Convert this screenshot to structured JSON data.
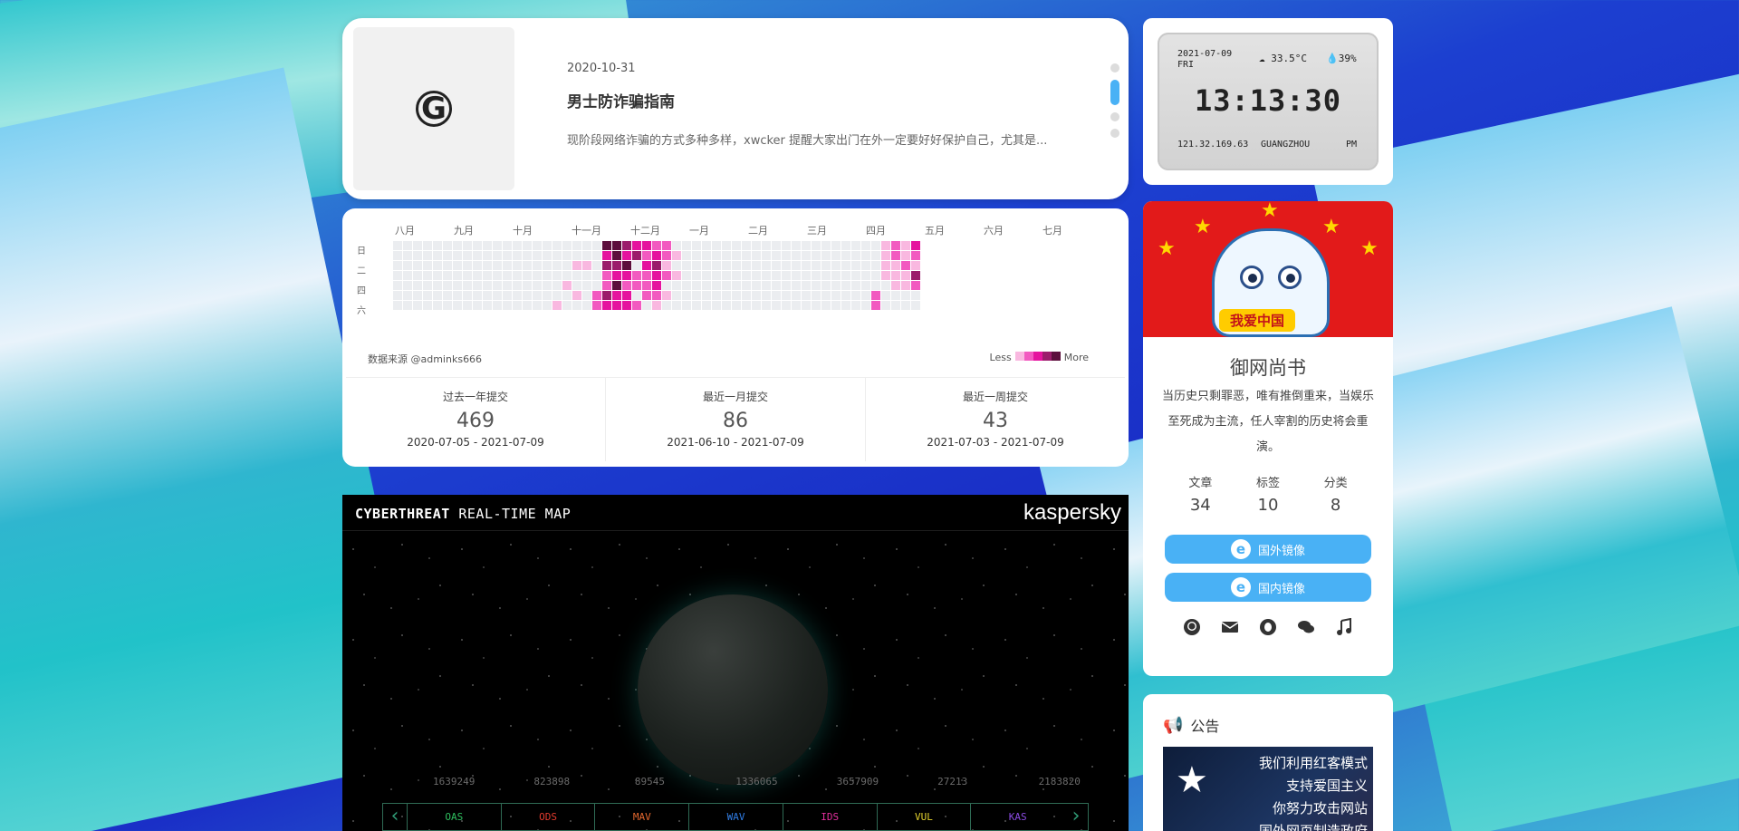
{
  "post": {
    "date": "2020-10-31",
    "title": "男士防诈骗指南",
    "excerpt": "现阶段网络诈骗的方式多种多样，xwcker 提醒大家出门在外一定要好好保护自己，尤其是...",
    "thumb_letter": "G"
  },
  "contributions": {
    "months": [
      "八月",
      "九月",
      "十月",
      "十一月",
      "十二月",
      "一月",
      "二月",
      "三月",
      "四月",
      "五月",
      "六月",
      "七月"
    ],
    "weekdays": [
      "日",
      "二",
      "四",
      "六"
    ],
    "source": "数据来源 @adminks666",
    "legend_less": "Less",
    "legend_more": "More",
    "colors": [
      "#ebedf0",
      "#f9b8e0",
      "#f25ac0",
      "#e5139e",
      "#9b1c6b",
      "#5c0e3c"
    ],
    "stats": [
      {
        "label": "过去一年提交",
        "value": "469",
        "range": "2020-07-05 - 2021-07-09"
      },
      {
        "label": "最近一月提交",
        "value": "86",
        "range": "2021-06-10 - 2021-07-09"
      },
      {
        "label": "最近一周提交",
        "value": "43",
        "range": "2021-07-03 - 2021-07-09"
      }
    ]
  },
  "cybermap": {
    "title_bold": "CYBERTHREAT",
    "title_rest": " REAL-TIME MAP",
    "brand": "kaspersky",
    "counts": [
      "1639249",
      "823898",
      "89545",
      "1336065",
      "3657909",
      "27213",
      "2183820"
    ],
    "nav": [
      {
        "label": "OAS",
        "color": "#2fbf5f"
      },
      {
        "label": "ODS",
        "color": "#e23b2e"
      },
      {
        "label": "MAV",
        "color": "#e2672e"
      },
      {
        "label": "WAV",
        "color": "#2e7be2"
      },
      {
        "label": "IDS",
        "color": "#e22e9c"
      },
      {
        "label": "VUL",
        "color": "#e2d12e"
      },
      {
        "label": "KAS",
        "color": "#8a4be2"
      }
    ]
  },
  "clock": {
    "date": "2021-07-09",
    "dow": "FRI",
    "temp": "33.5°C",
    "humidity": "39%",
    "time": "13:13:30",
    "ip": "121.32.169.63",
    "city": "GUANGZHOU",
    "ampm": "PM"
  },
  "author": {
    "banner_text": "我爱中国",
    "name": "御网尚书",
    "desc": "当历史只剩罪恶，唯有推倒重来，当娱乐至死成为主流，任人宰割的历史将会重演。",
    "counters": [
      {
        "label": "文章",
        "value": "34"
      },
      {
        "label": "标签",
        "value": "10"
      },
      {
        "label": "分类",
        "value": "8"
      }
    ],
    "buttons": [
      {
        "label": "国外镜像"
      },
      {
        "label": "国内镜像"
      }
    ],
    "socials": [
      "github-icon",
      "envelope-icon",
      "qq-icon",
      "comments-icon",
      "music-icon"
    ]
  },
  "notice": {
    "title": "公告",
    "lines": [
      "我们利用红客模式",
      "支持爱国主义",
      "你努力攻击网站",
      "国外网页制造政府"
    ]
  }
}
